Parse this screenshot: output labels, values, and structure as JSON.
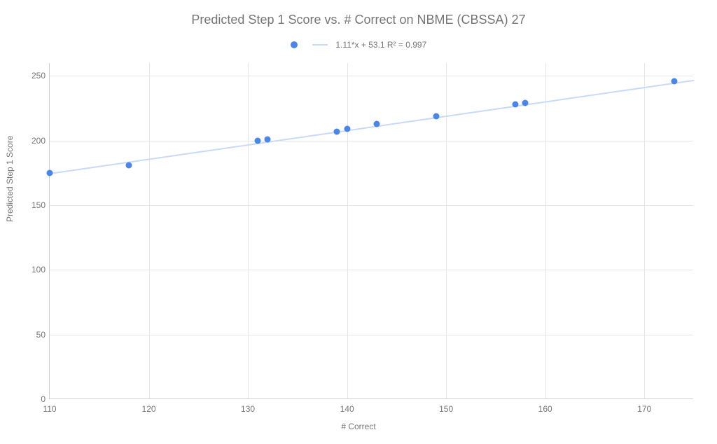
{
  "chart_data": {
    "type": "scatter",
    "title": "Predicted Step 1 Score vs. # Correct on NBME (CBSSA) 27",
    "xlabel": "# Correct",
    "ylabel": "Predicted Step 1 Score",
    "xlim": [
      110,
      175
    ],
    "ylim": [
      0,
      260
    ],
    "x_ticks": [
      110,
      120,
      130,
      140,
      150,
      160,
      170
    ],
    "y_ticks": [
      0,
      50,
      100,
      150,
      200,
      250
    ],
    "legend_equation": "1.11*x + 53.1 R² = 0.997",
    "series": [
      {
        "name": "data",
        "type": "scatter",
        "x": [
          110,
          118,
          131,
          132,
          139,
          140,
          143,
          149,
          157,
          158,
          173
        ],
        "y": [
          175,
          181,
          200,
          201,
          207,
          209,
          213,
          219,
          228,
          229,
          246
        ]
      },
      {
        "name": "trendline",
        "type": "line",
        "equation": "y = 1.11*x + 53.1",
        "r_squared": 0.997,
        "x": [
          110,
          175
        ],
        "y": [
          175.2,
          247.35
        ]
      }
    ]
  }
}
